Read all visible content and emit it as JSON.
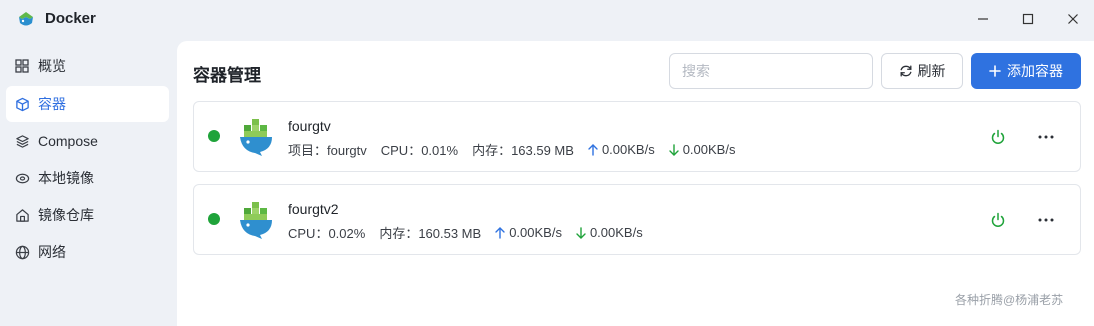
{
  "app": {
    "title": "Docker"
  },
  "sidebar": {
    "items": [
      {
        "label": "概览",
        "icon": "grid-icon",
        "active": false
      },
      {
        "label": "容器",
        "icon": "cube-icon",
        "active": true
      },
      {
        "label": "Compose",
        "icon": "layers-icon",
        "active": false
      },
      {
        "label": "本地镜像",
        "icon": "disk-icon",
        "active": false
      },
      {
        "label": "镜像仓库",
        "icon": "home-icon",
        "active": false
      },
      {
        "label": "网络",
        "icon": "globe-icon",
        "active": false
      }
    ]
  },
  "main": {
    "title": "容器管理",
    "search_placeholder": "搜索",
    "refresh_label": "刷新",
    "add_label": "添加容器"
  },
  "containers": [
    {
      "name": "fourgtv",
      "project": "项目：fourgtv",
      "cpu": "CPU：0.01%",
      "memory": "内存：163.59 MB",
      "upload": "0.00KB/s",
      "download": "0.00KB/s",
      "status": "running"
    },
    {
      "name": "fourgtv2",
      "cpu": "CPU：0.02%",
      "memory": "内存：160.53 MB",
      "upload": "0.00KB/s",
      "download": "0.00KB/s",
      "status": "running"
    }
  ],
  "watermark": "各种折腾@杨浦老苏",
  "colors": {
    "accent": "#2f72e0",
    "running": "#1fa33a",
    "upload_arrow": "#2f72e0",
    "download_arrow": "#1fa33a"
  }
}
